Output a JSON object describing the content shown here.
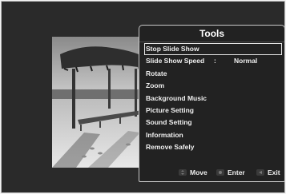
{
  "menu": {
    "title": "Tools",
    "items": [
      {
        "label": "Stop Slide Show",
        "selected": true
      },
      {
        "label": "Slide Show Speed",
        "colon": ":",
        "value": "Normal"
      },
      {
        "label": "Rotate"
      },
      {
        "label": "Zoom"
      },
      {
        "label": "Background Music"
      },
      {
        "label": "Picture Setting"
      },
      {
        "label": "Sound Setting"
      },
      {
        "label": "Information"
      },
      {
        "label": "Remove Safely"
      }
    ]
  },
  "footer": {
    "move_label": "Move",
    "enter_label": "Enter",
    "exit_label": "Exit",
    "move_icon": "move-arrows-icon",
    "enter_icon": "enter-icon",
    "exit_icon": "exit-icon"
  },
  "colors": {
    "screen_bg": "#2a2a2a",
    "menu_bg": "#222222",
    "menu_border": "#c8c8c8"
  }
}
